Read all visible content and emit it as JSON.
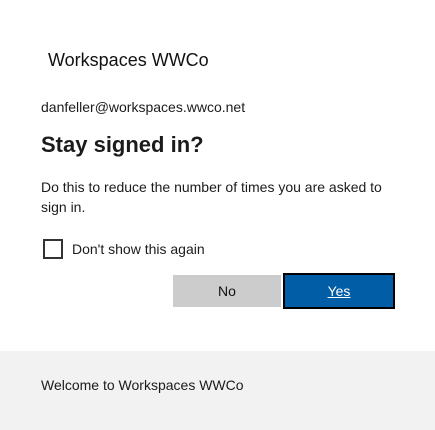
{
  "logo_text": "Workspaces WWCo",
  "account_email": "danfeller@workspaces.wwco.net",
  "title": "Stay signed in?",
  "description": "Do this to reduce the number of times you are asked to sign in.",
  "checkbox": {
    "label": "Don't show this again",
    "checked": false
  },
  "buttons": {
    "no": "No",
    "yes": "Yes"
  },
  "footer": {
    "text": "Welcome to Workspaces WWCo"
  },
  "colors": {
    "primary": "#005da6",
    "secondary_button": "#cccccc",
    "footer_bg": "#f2f2f2"
  }
}
